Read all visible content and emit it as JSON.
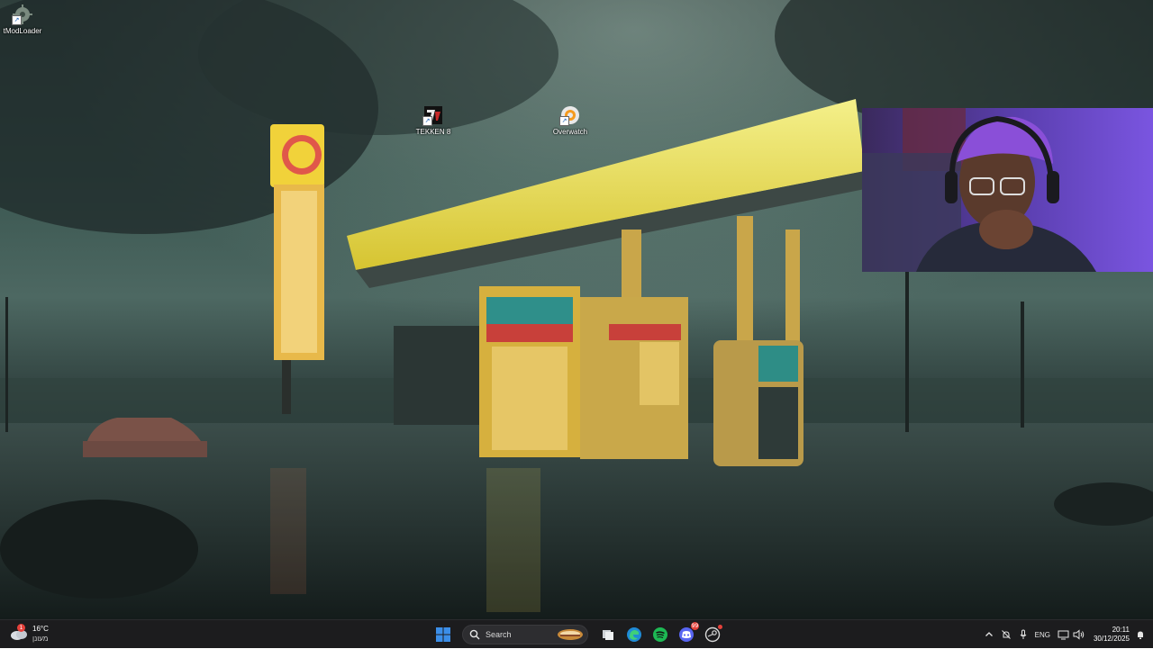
{
  "desktop_icons": [
    {
      "label": "tModLoader",
      "icon": "tmodloader-icon"
    },
    {
      "label": "TEKKEN 8",
      "icon": "tekken-8-icon"
    },
    {
      "label": "Overwatch",
      "icon": "overwatch-icon"
    }
  ],
  "webcam": {
    "icon": "webcam-overlay"
  },
  "taskbar": {
    "weather": {
      "temperature": "16°C",
      "condition": "מעונן",
      "icon": "cloudy-weather-icon",
      "badge": "1"
    },
    "start": {
      "icon": "windows-start-icon"
    },
    "search": {
      "placeholder": "Search",
      "icon": "search-icon"
    },
    "pinned": [
      {
        "name": "task-view",
        "icon": "task-view-icon"
      },
      {
        "name": "edge",
        "icon": "edge-icon"
      },
      {
        "name": "spotify",
        "icon": "spotify-icon"
      },
      {
        "name": "discord",
        "icon": "discord-icon",
        "badge": "99"
      },
      {
        "name": "steam",
        "icon": "steam-icon"
      }
    ],
    "tray": {
      "language": "ENG",
      "time": "20:11",
      "date": "30/12/2025"
    }
  },
  "colors": {
    "taskbar_bg": "#1c1c1e",
    "accent_blue": "#3b8ee8",
    "spotify_green": "#1db954",
    "discord_blurple": "#5865f2",
    "badge_red": "#e5413b"
  }
}
